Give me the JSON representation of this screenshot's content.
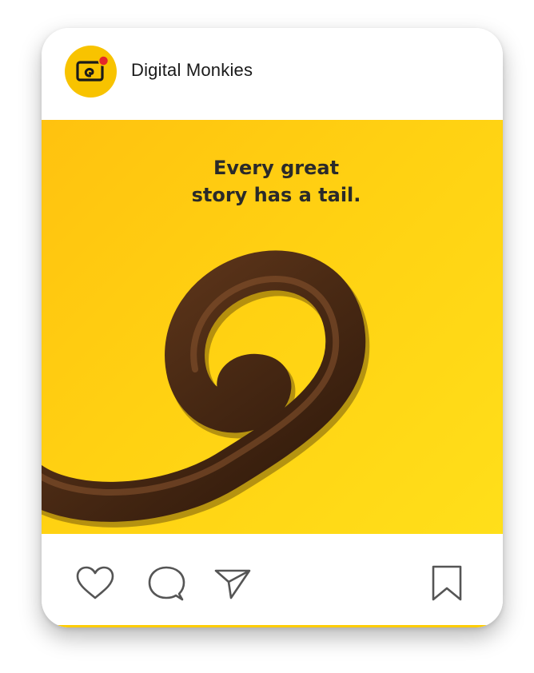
{
  "account": {
    "name": "Digital Monkies",
    "avatar_icon": "camera-logo-icon",
    "brand_color": "#f8c300",
    "notification_dot_color": "#e5262a"
  },
  "post": {
    "caption_line1": "Every great",
    "caption_line2": "story has a tail.",
    "background_color": "#ffd112",
    "illustration": "monkey-tail-illustration",
    "tail_color": "#4a2a14"
  },
  "actions": {
    "like_icon": "heart-icon",
    "comment_icon": "comment-icon",
    "share_icon": "send-icon",
    "save_icon": "bookmark-icon"
  }
}
